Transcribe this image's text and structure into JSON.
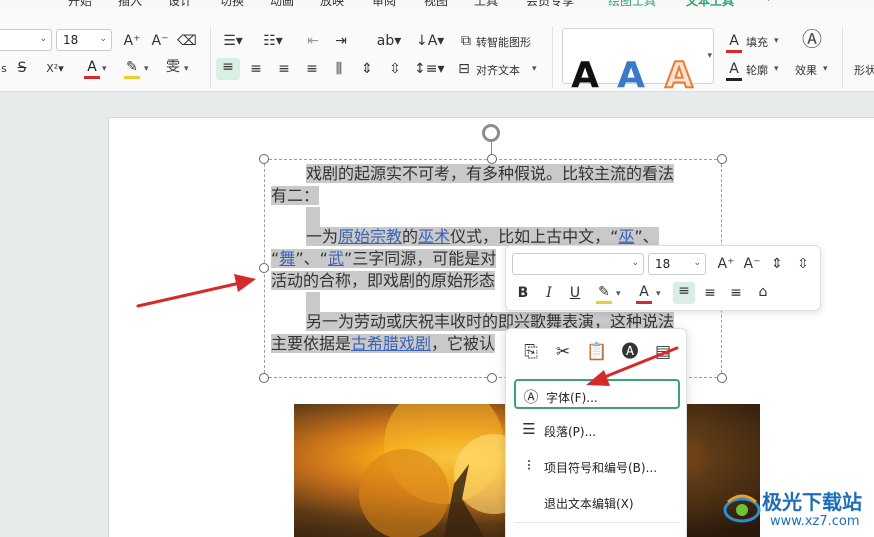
{
  "tabs": [
    {
      "label": "开始"
    },
    {
      "label": "插入"
    },
    {
      "label": "设计"
    },
    {
      "label": "切换"
    },
    {
      "label": "动画"
    },
    {
      "label": "放映"
    },
    {
      "label": "审阅"
    },
    {
      "label": "视图"
    },
    {
      "label": "工具"
    },
    {
      "label": "会员专享"
    },
    {
      "label": "绘图工具"
    },
    {
      "label": "文本工具"
    }
  ],
  "ribbon": {
    "font_size": "18",
    "smart_shape_label": "转智能图形",
    "align_text_label": "对齐文本",
    "fill_label": "填充",
    "outline_label": "轮廓",
    "effect_label": "效果",
    "shape_cut_label": "形状"
  },
  "document": {
    "p1_line1": "戏剧的起源实不可考，有多种假说。比较主流的看法",
    "p1_line2": "有二：",
    "p2_line1_a": "一为",
    "p2_line1_link1": "原始宗教",
    "p2_line1_b": "的",
    "p2_line1_link2": "巫术",
    "p2_line1_c": "仪式，比如上古中文，“",
    "p2_line1_link3": "巫",
    "p2_line1_d": "”、",
    "p2_line2_a": "“",
    "p2_line2_link1": "舞",
    "p2_line2_b": "”、“",
    "p2_line2_link2": "武",
    "p2_line2_c": "”三字同源，可能是对",
    "p2_line3": "活动的合称，即戏剧的原始形态",
    "p3_line1": "另一为劳动或庆祝丰收时的即兴歌舞表演，这种说法",
    "p3_line2_a": "主要依据是",
    "p3_line2_link": "古希腊戏剧",
    "p3_line2_b": "，它被认"
  },
  "mini_toolbar": {
    "font_size": "18"
  },
  "context_menu": {
    "items": [
      {
        "label": "字体(F)..."
      },
      {
        "label": "段落(P)..."
      },
      {
        "label": "项目符号和编号(B)..."
      },
      {
        "label": "退出文本编辑(X)"
      }
    ]
  },
  "watermark": {
    "title": "极光下载站",
    "url": "www.xz7.com"
  },
  "colors": {
    "accent_green": "#2aa76b",
    "arrow_red": "#d42a2a",
    "selection_gray": "#c9c9c9",
    "link_blue": "#3b63b7"
  }
}
